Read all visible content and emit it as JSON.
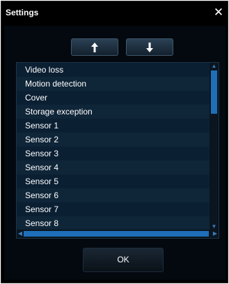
{
  "dialog": {
    "title": "Settings",
    "close_label": "✕"
  },
  "toolbar": {
    "move_up_icon": "arrow-up-icon",
    "move_down_icon": "arrow-down-icon"
  },
  "list": {
    "items": [
      "Video loss",
      "Motion detection",
      "Cover",
      "Storage exception",
      "Sensor 1",
      "Sensor 2",
      "Sensor 3",
      "Sensor 4",
      "Sensor 5",
      "Sensor 6",
      "Sensor 7",
      "Sensor 8"
    ]
  },
  "footer": {
    "ok_label": "OK"
  },
  "colors": {
    "background": "#000000",
    "panel": "#03090f",
    "list_bg": "#0c1a26",
    "scroll_thumb": "#1f6fb8",
    "button_top": "#2b4154"
  }
}
